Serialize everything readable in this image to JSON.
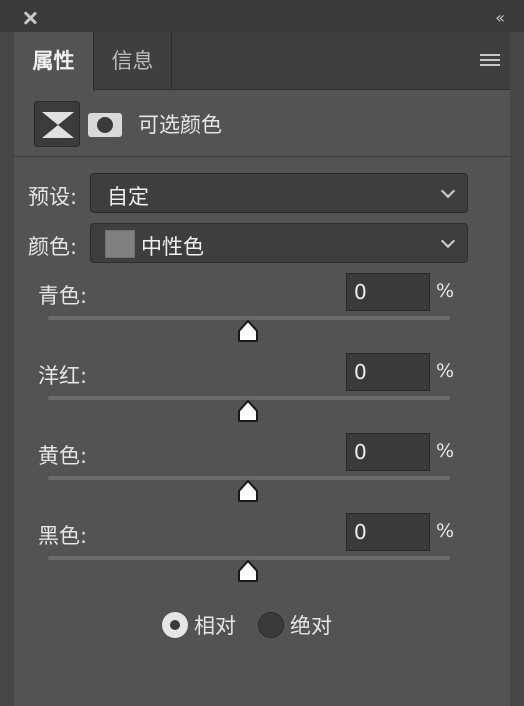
{
  "tabs": [
    {
      "label": "属性",
      "active": true
    },
    {
      "label": "信息",
      "active": false
    }
  ],
  "icons": {
    "close": "close-icon",
    "collapse": "double-chevron-left-icon",
    "menu": "hamburger-menu-icon",
    "adjustment": "selective-color-adjustment-icon",
    "mask": "layer-mask-icon"
  },
  "collapse_glyph": "‹‹",
  "header": {
    "title": "可选颜色"
  },
  "preset": {
    "label": "预设:",
    "value": "自定"
  },
  "colors": {
    "label": "颜色:",
    "value": "中性色",
    "swatch": "#808080"
  },
  "sliders": [
    {
      "label": "青色:",
      "value": "0",
      "unit": "%"
    },
    {
      "label": "洋红:",
      "value": "0",
      "unit": "%"
    },
    {
      "label": "黄色:",
      "value": "0",
      "unit": "%"
    },
    {
      "label": "黑色:",
      "value": "0",
      "unit": "%"
    }
  ],
  "method": {
    "options": [
      {
        "label": "相对",
        "selected": true
      },
      {
        "label": "绝对",
        "selected": false
      }
    ]
  }
}
